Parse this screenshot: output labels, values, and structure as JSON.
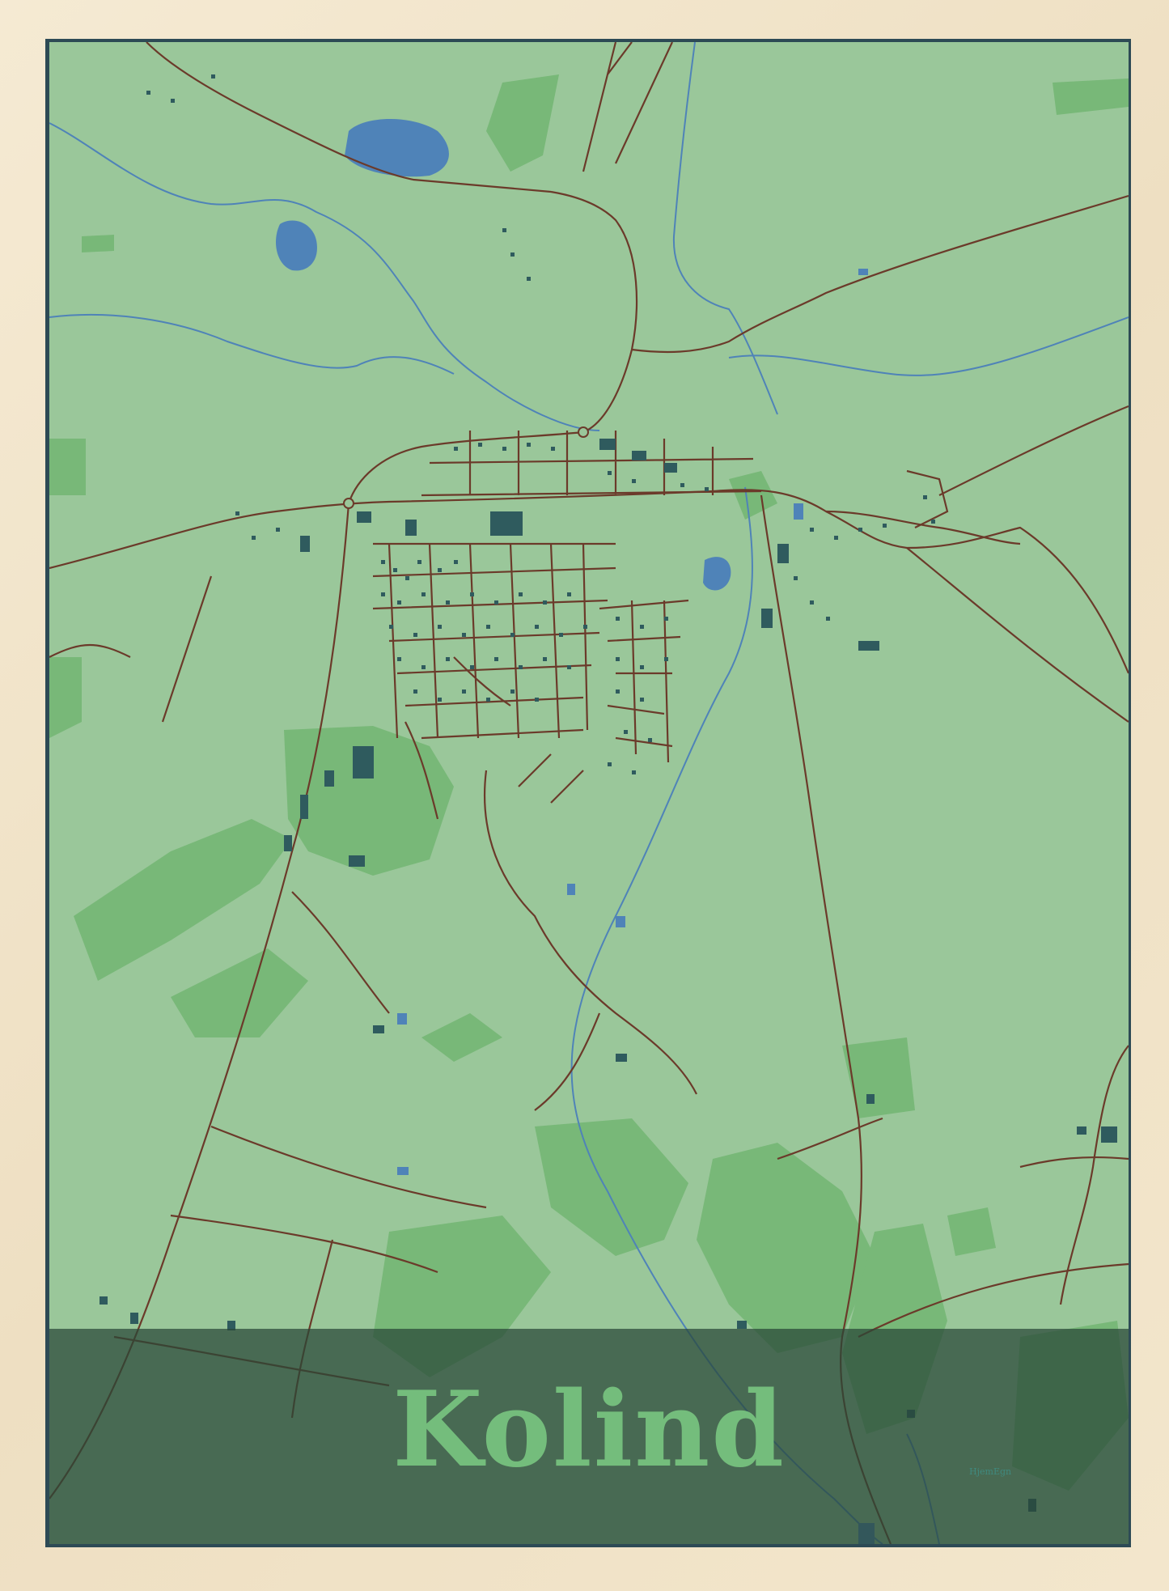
{
  "poster": {
    "title": "Kolind",
    "brand": "HjemEgn"
  },
  "colors": {
    "frame": "#f3e7cf",
    "land": "#9ac79a",
    "forest": "#76b677",
    "water": "#4f83b8",
    "roads": "#6b3a2a",
    "buildings": "#2f5b5e",
    "title_band": "#3f5f48",
    "title_text": "#74bd7c"
  },
  "map_layers": [
    "land",
    "forest",
    "water",
    "roads",
    "buildings"
  ]
}
